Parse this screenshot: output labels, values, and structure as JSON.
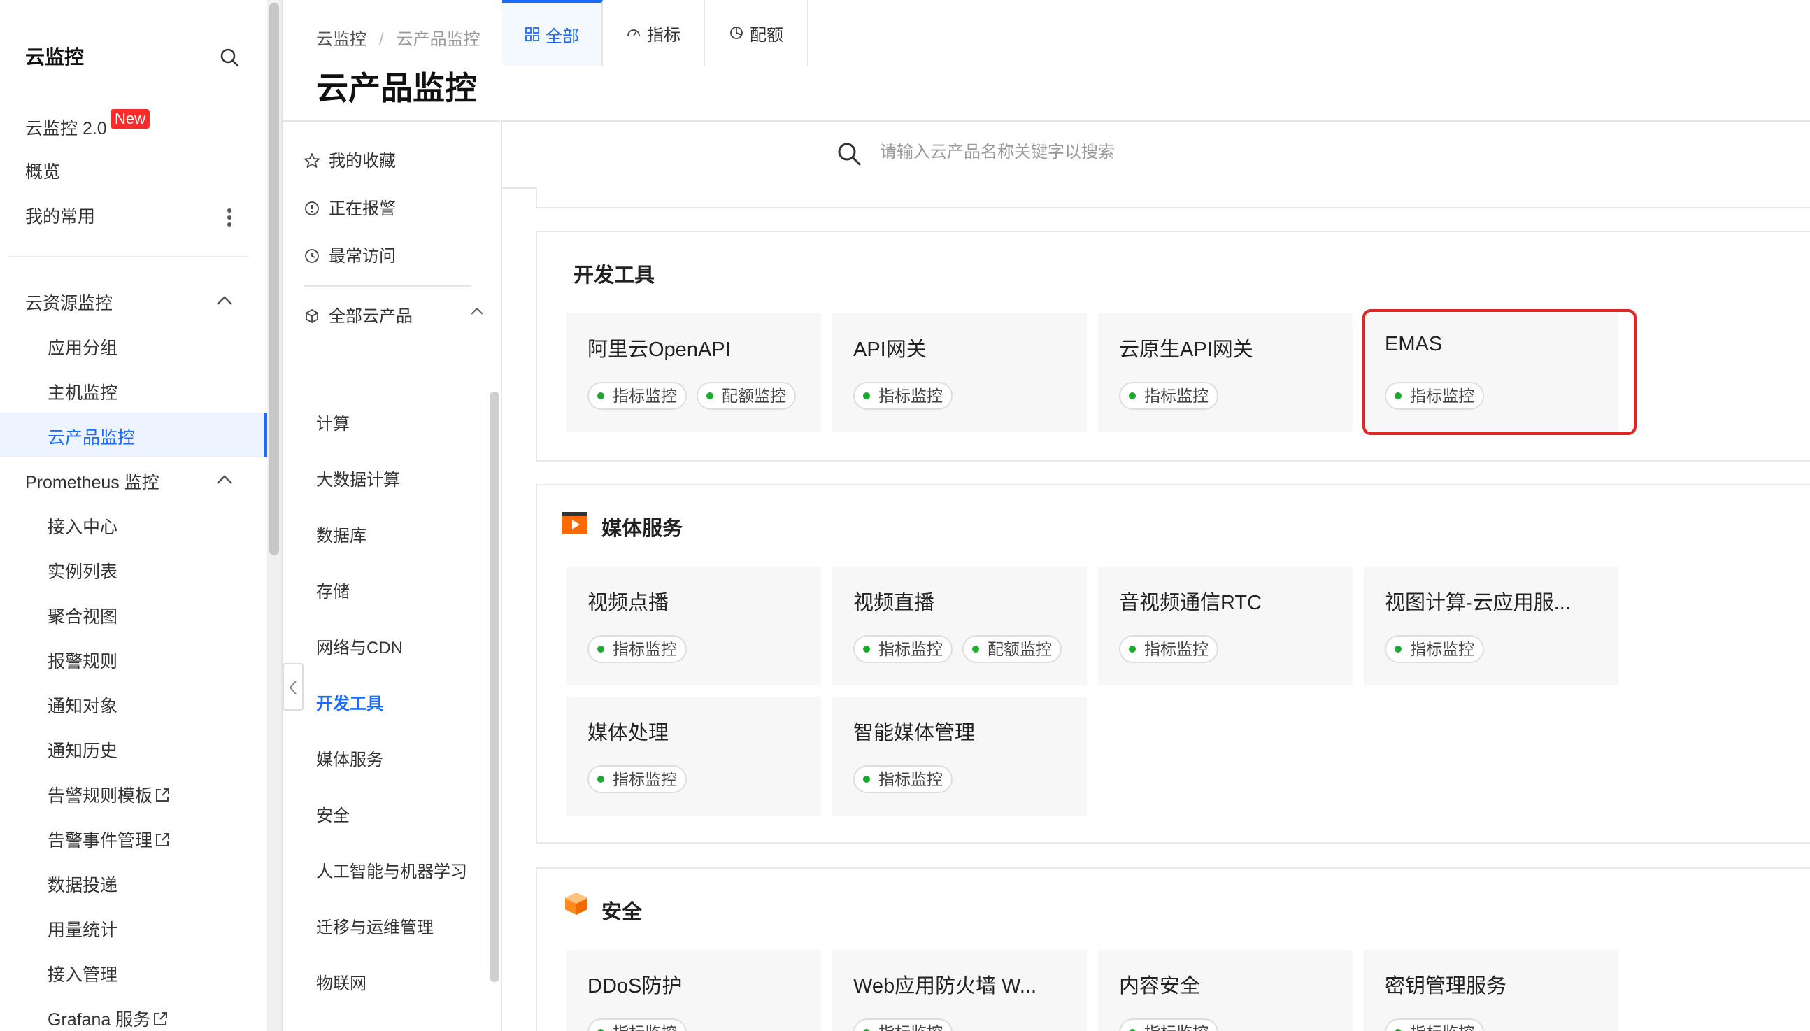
{
  "sidebar": {
    "title": "云监控",
    "cms2": "云监控 2.0",
    "cms2_badge": "New",
    "overview": "概览",
    "favorites": "我的常用",
    "resource_group": "云资源监控",
    "app_group": "应用分组",
    "host_monitor": "主机监控",
    "cloud_product": "云产品监控",
    "prometheus": "Prometheus 监控",
    "access_center": "接入中心",
    "instance_list": "实例列表",
    "aggregate_view": "聚合视图",
    "alert_rules": "报警规则",
    "notify_target": "通知对象",
    "notify_history": "通知历史",
    "alert_template": "告警规则模板",
    "alert_event": "告警事件管理",
    "data_delivery": "数据投递",
    "usage_stats": "用量统计",
    "access_mgmt": "接入管理",
    "grafana": "Grafana 服务"
  },
  "breadcrumb": {
    "root": "云监控",
    "sep": "/",
    "current": "云产品监控"
  },
  "page_title": "云产品监控",
  "filters": {
    "my_favorites": "我的收藏",
    "alerting": "正在报警",
    "most_visited": "最常访问",
    "all_products": "全部云产品"
  },
  "categories": [
    "计算",
    "大数据计算",
    "数据库",
    "存储",
    "网络与CDN",
    "开发工具",
    "媒体服务",
    "安全",
    "人工智能与机器学习",
    "迁移与运维管理",
    "物联网"
  ],
  "active_category": "开发工具",
  "tabs": {
    "all": "全部",
    "metric": "指标",
    "quota": "配额"
  },
  "search": {
    "placeholder": "请输入云产品名称关键字以搜索"
  },
  "sections": [
    {
      "title": "开发工具",
      "cards": [
        {
          "title": "阿里云OpenAPI",
          "chips": [
            "指标监控",
            "配额监控"
          ]
        },
        {
          "title": "API网关",
          "chips": [
            "指标监控"
          ]
        },
        {
          "title": "云原生API网关",
          "chips": [
            "指标监控"
          ]
        },
        {
          "title": "EMAS",
          "chips": [
            "指标监控"
          ]
        }
      ]
    },
    {
      "title": "媒体服务",
      "cards": [
        {
          "title": "视频点播",
          "chips": [
            "指标监控"
          ]
        },
        {
          "title": "视频直播",
          "chips": [
            "指标监控",
            "配额监控"
          ]
        },
        {
          "title": "音视频通信RTC",
          "chips": [
            "指标监控"
          ]
        },
        {
          "title": "视图计算-云应用服...",
          "chips": [
            "指标监控"
          ]
        },
        {
          "title": "媒体处理",
          "chips": [
            "指标监控"
          ]
        },
        {
          "title": "智能媒体管理",
          "chips": [
            "指标监控"
          ]
        }
      ]
    },
    {
      "title": "安全",
      "cards": [
        {
          "title": "DDoS防护",
          "chips": [
            "指标监控"
          ]
        },
        {
          "title": "Web应用防火墙 W...",
          "chips": [
            "指标监控"
          ]
        },
        {
          "title": "内容安全",
          "chips": [
            "指标监控"
          ]
        },
        {
          "title": "密钥管理服务",
          "chips": [
            "指标监控"
          ]
        }
      ]
    }
  ],
  "colors": {
    "accent": "#1a6bff",
    "badge": "#ff2a2a",
    "status_dot": "#1aab2c",
    "highlight": "#e12424"
  },
  "icons": [
    "search-icon",
    "more-vertical-icon",
    "chevron-up-icon",
    "external-link-icon",
    "star-icon",
    "alert-circle-icon",
    "clock-icon",
    "cube-icon",
    "grid-icon",
    "gauge-icon",
    "pie-icon",
    "chevron-left-icon",
    "media-icon",
    "security-icon"
  ]
}
